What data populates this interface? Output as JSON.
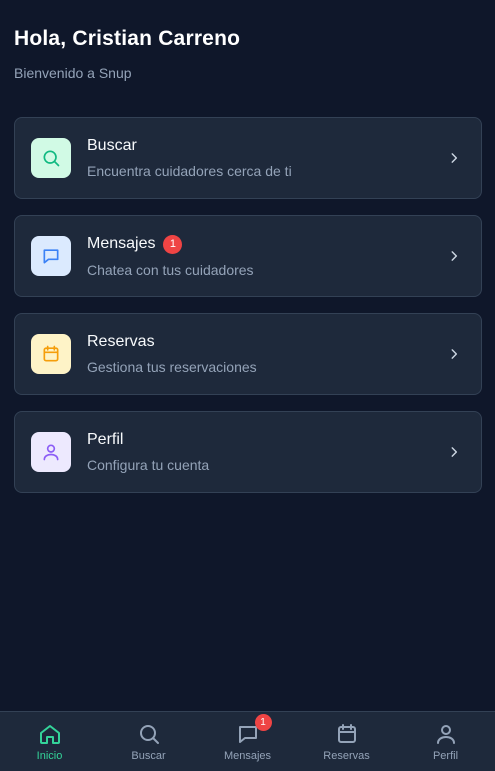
{
  "header": {
    "greeting": "Hola, Cristian Carreno",
    "subtitle": "Bienvenido a Snup"
  },
  "cards": [
    {
      "title": "Buscar",
      "description": "Encuentra cuidadores cerca de ti",
      "icon": "search-icon",
      "icon_color": "#10b981",
      "icon_bg": "#d1fae5"
    },
    {
      "title": "Mensajes",
      "description": "Chatea con tus cuidadores",
      "icon": "chat-icon",
      "icon_color": "#3b82f6",
      "icon_bg": "#dbeafe",
      "badge": "1"
    },
    {
      "title": "Reservas",
      "description": "Gestiona tus reservaciones",
      "icon": "calendar-icon",
      "icon_color": "#f59e0b",
      "icon_bg": "#fef3c7"
    },
    {
      "title": "Perfil",
      "description": "Configura tu cuenta",
      "icon": "user-icon",
      "icon_color": "#8b5cf6",
      "icon_bg": "#ede9fe"
    }
  ],
  "tabbar": {
    "items": [
      {
        "label": "Inicio",
        "icon": "home-icon",
        "active": true
      },
      {
        "label": "Buscar",
        "icon": "search-icon"
      },
      {
        "label": "Mensajes",
        "icon": "chat-icon",
        "badge": "1"
      },
      {
        "label": "Reservas",
        "icon": "calendar-icon"
      },
      {
        "label": "Perfil",
        "icon": "user-icon"
      }
    ]
  },
  "colors": {
    "background": "#0f172a",
    "card": "#1e293b",
    "accent": "#34d399",
    "badge": "#ef4444"
  }
}
